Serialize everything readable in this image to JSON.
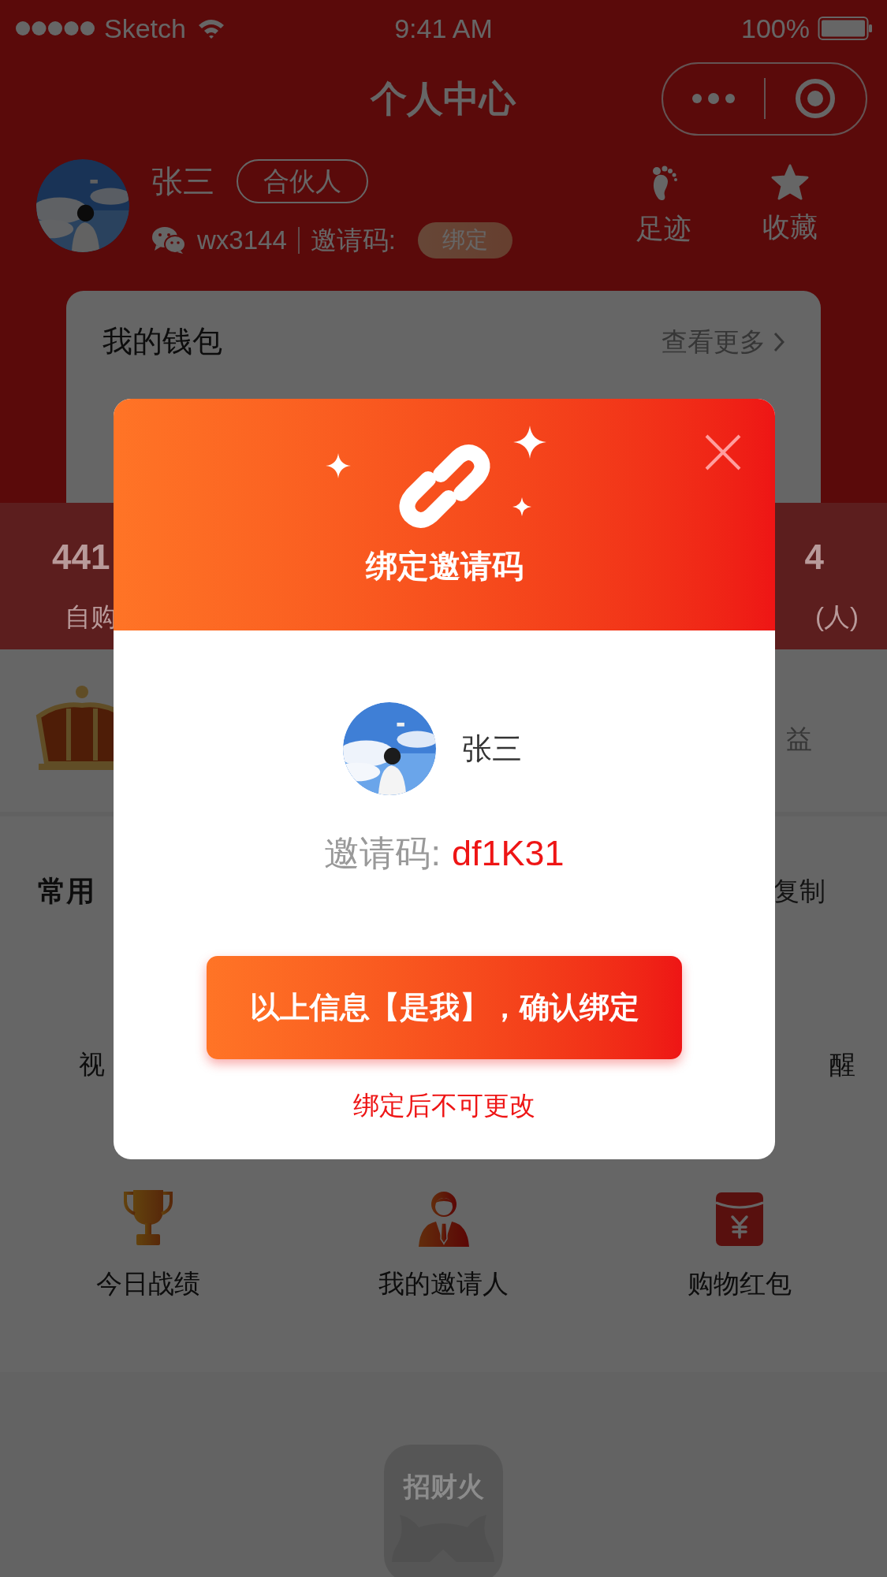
{
  "status_bar": {
    "carrier": "Sketch",
    "time": "9:41 AM",
    "battery": "100%"
  },
  "nav": {
    "title": "个人中心"
  },
  "profile": {
    "name": "张三",
    "badge": "合伙人",
    "wechat_id": "wx3144",
    "invite_label": "邀请码:",
    "bind_button": "绑定",
    "shortcuts": [
      {
        "label": "足迹",
        "kind": "footprint"
      },
      {
        "label": "收藏",
        "kind": "star"
      }
    ]
  },
  "wallet": {
    "title": "我的钱包",
    "more": "查看更多"
  },
  "stats": [
    {
      "value": "441",
      "label": "自购"
    },
    {
      "value": "4",
      "label": "(人)"
    }
  ],
  "membership": {
    "text": "益"
  },
  "tools": {
    "title": "常用",
    "action": "复制",
    "row_1": [
      "视",
      "醒"
    ],
    "items": [
      {
        "label": "今日战绩",
        "kind": "trophy"
      },
      {
        "label": "我的邀请人",
        "kind": "person"
      },
      {
        "label": "购物红包",
        "kind": "envelope"
      }
    ]
  },
  "footer": {
    "logo_text": "招财火"
  },
  "modal": {
    "title": "绑定邀请码",
    "name": "张三",
    "code_label": "邀请码:",
    "code": "df1K31",
    "confirm_button": "以上信息【是我】，确认绑定",
    "note": "绑定后不可更改"
  }
}
